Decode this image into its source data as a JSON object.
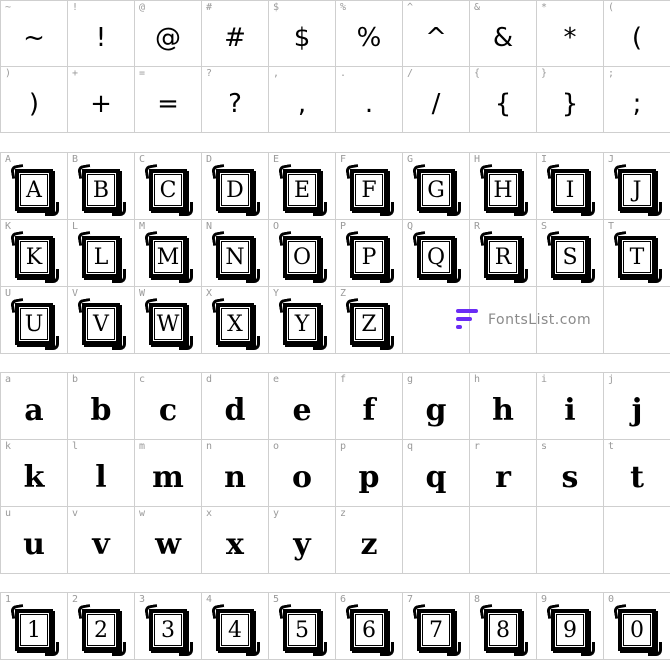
{
  "symbols": [
    {
      "label": "~",
      "glyph": "~"
    },
    {
      "label": "!",
      "glyph": "!"
    },
    {
      "label": "@",
      "glyph": "@"
    },
    {
      "label": "#",
      "glyph": "#"
    },
    {
      "label": "$",
      "glyph": "$"
    },
    {
      "label": "%",
      "glyph": "%"
    },
    {
      "label": "^",
      "glyph": "^"
    },
    {
      "label": "&",
      "glyph": "&"
    },
    {
      "label": "*",
      "glyph": "*"
    },
    {
      "label": "(",
      "glyph": "("
    },
    {
      "label": ")",
      "glyph": ")"
    },
    {
      "label": "+",
      "glyph": "+"
    },
    {
      "label": "=",
      "glyph": "="
    },
    {
      "label": "?",
      "glyph": "?"
    },
    {
      "label": ",",
      "glyph": ","
    },
    {
      "label": ".",
      "glyph": "."
    },
    {
      "label": "/",
      "glyph": "/"
    },
    {
      "label": "{",
      "glyph": "{"
    },
    {
      "label": "}",
      "glyph": "}"
    },
    {
      "label": ";",
      "glyph": ";"
    }
  ],
  "uppercase": [
    {
      "label": "A",
      "glyph": "A"
    },
    {
      "label": "B",
      "glyph": "B"
    },
    {
      "label": "C",
      "glyph": "C"
    },
    {
      "label": "D",
      "glyph": "D"
    },
    {
      "label": "E",
      "glyph": "E"
    },
    {
      "label": "F",
      "glyph": "F"
    },
    {
      "label": "G",
      "glyph": "G"
    },
    {
      "label": "H",
      "glyph": "H"
    },
    {
      "label": "I",
      "glyph": "I"
    },
    {
      "label": "J",
      "glyph": "J"
    },
    {
      "label": "K",
      "glyph": "K"
    },
    {
      "label": "L",
      "glyph": "L"
    },
    {
      "label": "M",
      "glyph": "M"
    },
    {
      "label": "N",
      "glyph": "N"
    },
    {
      "label": "O",
      "glyph": "O"
    },
    {
      "label": "P",
      "glyph": "P"
    },
    {
      "label": "Q",
      "glyph": "Q"
    },
    {
      "label": "R",
      "glyph": "R"
    },
    {
      "label": "S",
      "glyph": "S"
    },
    {
      "label": "T",
      "glyph": "T"
    },
    {
      "label": "U",
      "glyph": "U"
    },
    {
      "label": "V",
      "glyph": "V"
    },
    {
      "label": "W",
      "glyph": "W"
    },
    {
      "label": "X",
      "glyph": "X"
    },
    {
      "label": "Y",
      "glyph": "Y"
    },
    {
      "label": "Z",
      "glyph": "Z"
    }
  ],
  "lowercase": [
    {
      "label": "a",
      "glyph": "a"
    },
    {
      "label": "b",
      "glyph": "b"
    },
    {
      "label": "c",
      "glyph": "c"
    },
    {
      "label": "d",
      "glyph": "d"
    },
    {
      "label": "e",
      "glyph": "e"
    },
    {
      "label": "f",
      "glyph": "f"
    },
    {
      "label": "g",
      "glyph": "g"
    },
    {
      "label": "h",
      "glyph": "h"
    },
    {
      "label": "i",
      "glyph": "i"
    },
    {
      "label": "j",
      "glyph": "j"
    },
    {
      "label": "k",
      "glyph": "k"
    },
    {
      "label": "l",
      "glyph": "l"
    },
    {
      "label": "m",
      "glyph": "m"
    },
    {
      "label": "n",
      "glyph": "n"
    },
    {
      "label": "o",
      "glyph": "o"
    },
    {
      "label": "p",
      "glyph": "p"
    },
    {
      "label": "q",
      "glyph": "q"
    },
    {
      "label": "r",
      "glyph": "r"
    },
    {
      "label": "s",
      "glyph": "s"
    },
    {
      "label": "t",
      "glyph": "t"
    },
    {
      "label": "u",
      "glyph": "u"
    },
    {
      "label": "v",
      "glyph": "v"
    },
    {
      "label": "w",
      "glyph": "w"
    },
    {
      "label": "x",
      "glyph": "x"
    },
    {
      "label": "y",
      "glyph": "y"
    },
    {
      "label": "z",
      "glyph": "z"
    }
  ],
  "digits": [
    {
      "label": "1",
      "glyph": "1"
    },
    {
      "label": "2",
      "glyph": "2"
    },
    {
      "label": "3",
      "glyph": "3"
    },
    {
      "label": "4",
      "glyph": "4"
    },
    {
      "label": "5",
      "glyph": "5"
    },
    {
      "label": "6",
      "glyph": "6"
    },
    {
      "label": "7",
      "glyph": "7"
    },
    {
      "label": "8",
      "glyph": "8"
    },
    {
      "label": "9",
      "glyph": "9"
    },
    {
      "label": "0",
      "glyph": "0"
    }
  ],
  "watermark": {
    "text": "FontsList.com",
    "icon": "fontslist-logo-icon",
    "color": "#6a2cf5"
  }
}
